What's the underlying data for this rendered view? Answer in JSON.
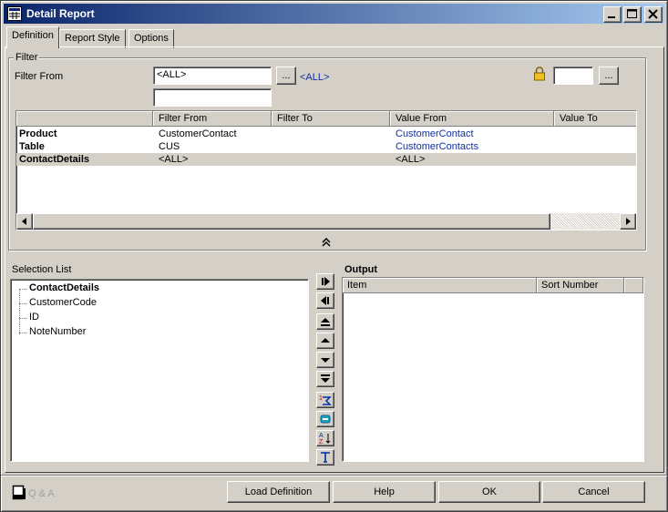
{
  "window": {
    "title": "Detail Report"
  },
  "tabs": [
    {
      "label": "Definition"
    },
    {
      "label": "Report Style"
    },
    {
      "label": "Options"
    }
  ],
  "filter": {
    "group_label": "Filter",
    "filter_from_label": "Filter From",
    "filter_from_value": "<ALL>",
    "filter_from_second_value": "",
    "browse_label": "...",
    "all_link": "<ALL>",
    "lock_value": "",
    "lock_browse_label": "...",
    "grid": {
      "columns": [
        "",
        "Filter From",
        "Filter To",
        "Value From",
        "Value To"
      ],
      "rows": [
        {
          "name": "Product",
          "filter_from": "CustomerContact",
          "filter_to": "",
          "value_from": "CustomerContact",
          "value_to": ""
        },
        {
          "name": "Table",
          "filter_from": "CUS",
          "filter_to": "",
          "value_from": "CustomerContacts",
          "value_to": ""
        },
        {
          "name": "ContactDetails",
          "filter_from": "<ALL>",
          "filter_to": "",
          "value_from": "<ALL>",
          "value_to": ""
        }
      ]
    },
    "collapse_glyph": "«"
  },
  "selection_list": {
    "label": "Selection List",
    "root": "ContactDetails",
    "items": [
      "CustomerCode",
      "ID",
      "NoteNumber"
    ]
  },
  "output": {
    "label": "Output",
    "columns": [
      "Item",
      "Sort Number"
    ]
  },
  "footer": {
    "qa_label": "Q & A",
    "load_definition": "Load Definition",
    "help": "Help",
    "ok": "OK",
    "cancel": "Cancel"
  },
  "colors": {
    "title_bar_start": "#0a246a",
    "title_bar_end": "#a6caf0",
    "link": "#1030a0",
    "face": "#d4d0c8"
  }
}
